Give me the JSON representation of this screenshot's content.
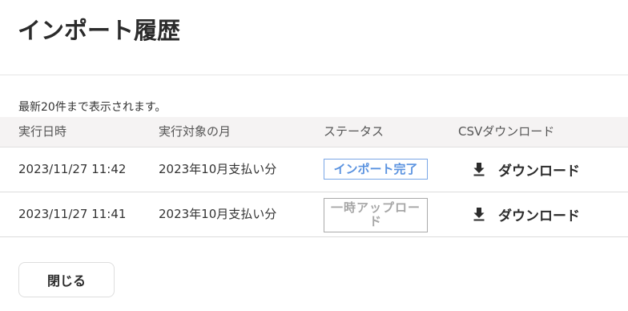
{
  "dialog": {
    "title": "インポート履歴",
    "note": "最新20件まで表示されます。"
  },
  "table": {
    "headers": [
      "実行日時",
      "実行対象の月",
      "ステータス",
      "CSVダウンロード"
    ],
    "rows": [
      {
        "executed_at": "2023/11/27 11:42",
        "target_month": "2023年10月支払い分",
        "status": "インポート完了",
        "status_type": "done",
        "download_label": "ダウンロード",
        "download_icon": "download-icon"
      },
      {
        "executed_at": "2023/11/27 11:41",
        "target_month": "2023年10月支払い分",
        "status": "一時アップロード",
        "status_type": "temporary",
        "download_label": "ダウンロード",
        "download_icon": "download-icon"
      }
    ]
  },
  "footer": {
    "close_label": "閉じる"
  },
  "colors": {
    "status_done": "#5b93e0",
    "status_temporary": "#a6a6a6",
    "header_bg": "#f5f3f3"
  }
}
